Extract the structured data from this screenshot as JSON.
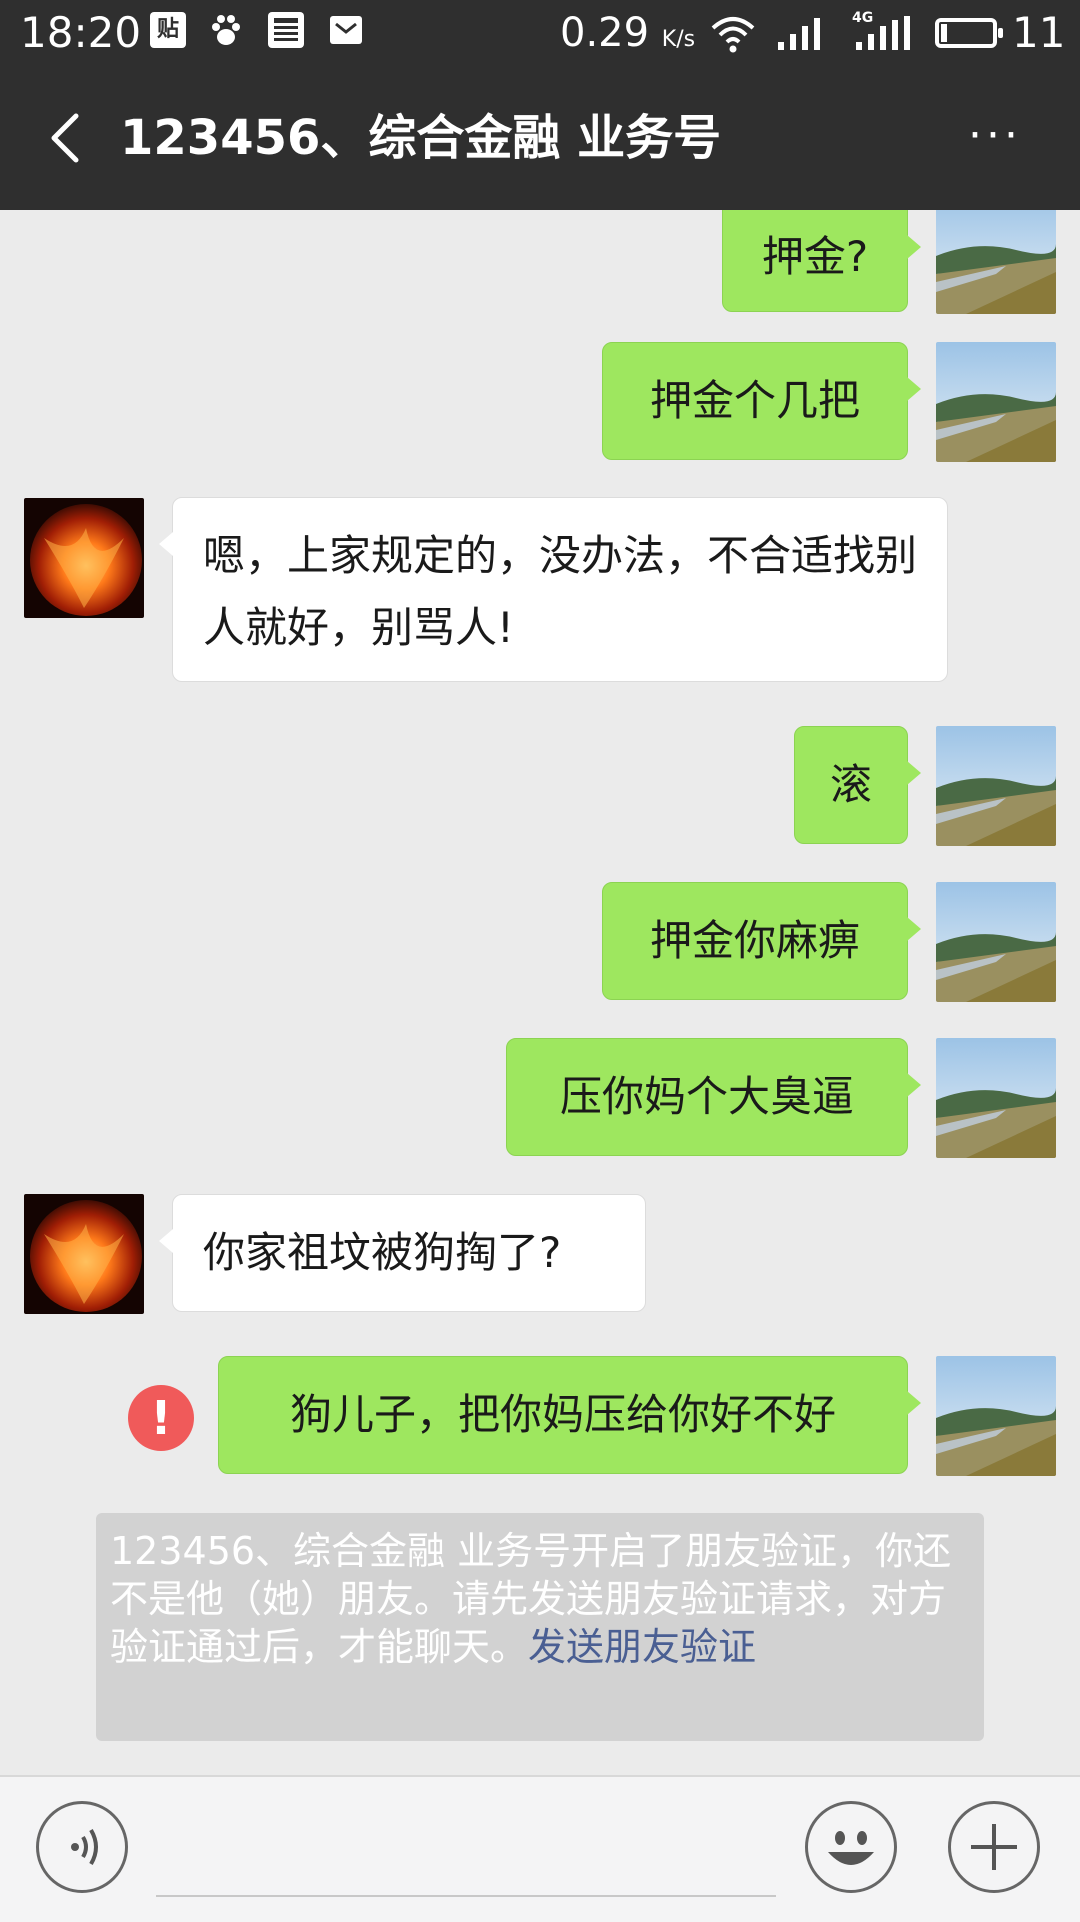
{
  "status_bar": {
    "time": "18:20",
    "icons": [
      "tieba-icon",
      "baidu-paw-icon",
      "news-icon",
      "mail-icon"
    ],
    "speed_value": "0.29",
    "speed_unit": "K/s",
    "network": "4G",
    "battery_level": "11"
  },
  "header": {
    "title": "123456、综合金融 业务号",
    "more_label": "···"
  },
  "messages": [
    {
      "side": "out",
      "text": "押金?"
    },
    {
      "side": "out",
      "text": "押金个几把"
    },
    {
      "side": "in",
      "text": "嗯，上家规定的，没办法，不合适找别人就好，别骂人!"
    },
    {
      "side": "out",
      "text": "滚"
    },
    {
      "side": "out",
      "text": "押金你麻痹"
    },
    {
      "side": "out",
      "text": "压你妈个大臭逼"
    },
    {
      "side": "in",
      "text": "你家祖坟被狗掏了?"
    },
    {
      "side": "out",
      "text": "狗儿子，把你妈压给你好不好",
      "failed": true
    }
  ],
  "error_mark": "!",
  "system_notice": {
    "text": "123456、综合金融 业务号开启了朋友验证，你还不是他（她）朋友。请先发送朋友验证请求，对方验证通过后，才能聊天。",
    "link": "发送朋友验证"
  },
  "input_bar": {
    "icons": [
      "voice-icon",
      "emoji-icon",
      "plus-icon"
    ]
  }
}
